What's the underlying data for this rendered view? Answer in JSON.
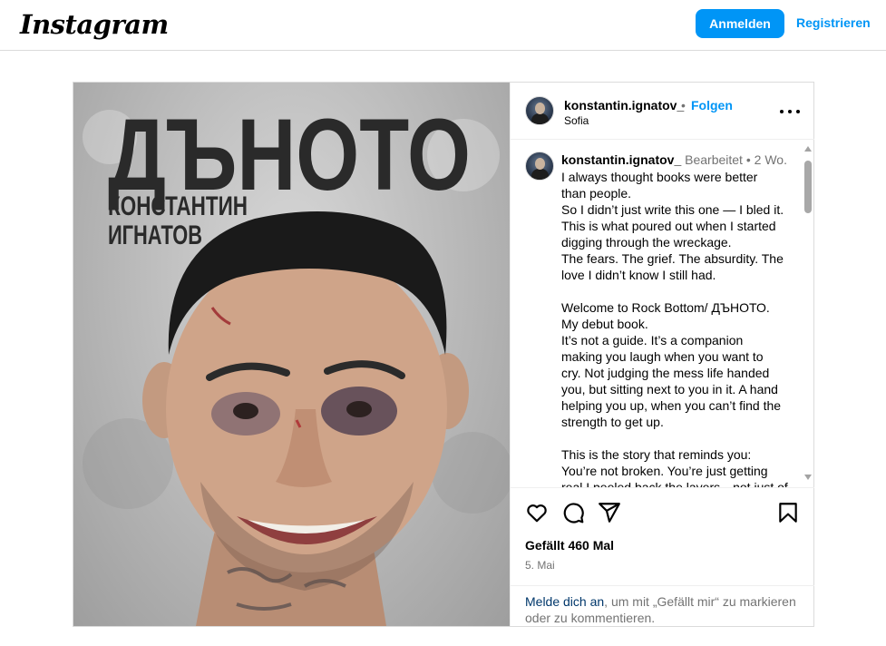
{
  "header": {
    "logo": "Instagram",
    "login_label": "Anmelden",
    "register_label": "Registrieren"
  },
  "post": {
    "image": {
      "title": "ДЪНОТО",
      "author_line1": "КОНСТАНТИН",
      "author_line2": "ИГНАТОВ"
    },
    "author": {
      "username": "konstantin.ignatov_",
      "separator": "•",
      "follow_label": "Folgen",
      "location": "Sofia"
    },
    "caption": {
      "username": "konstantin.ignatov_",
      "edited": "Bearbeitet",
      "separator": "•",
      "age": "2 Wo.",
      "lines": [
        "I always thought books were better",
        "than people.",
        "So I didn’t just write this one — I bled it.",
        "This is what poured out when I started",
        "digging through the wreckage.",
        "The fears. The grief. The absurdity. The",
        "love I didn’t know I still had.",
        "",
        "Welcome to Rock Bottom/ ДЪНОТО.",
        "My debut book.",
        "It’s not a guide. It’s a companion",
        "making you laugh when you want to",
        "cry. Not judging the mess life handed",
        "you, but sitting next to you in it. A hand",
        "helping you up, when you can’t find the",
        "strength to get up.",
        "",
        "This is the story that reminds you:",
        "You’re not broken. You’re just getting",
        "real.I peeled back the layers—not just of"
      ]
    },
    "likes": "Gefällt 460 Mal",
    "date": "5. Mai",
    "login_prompt": {
      "link": "Melde dich an",
      "rest": ", um mit „Gefällt mir“ zu markieren oder zu kommentieren."
    }
  },
  "icons": {
    "like": "heart-icon",
    "comment": "comment-icon",
    "share": "share-icon",
    "save": "bookmark-icon",
    "more": "more-options-icon"
  },
  "colors": {
    "accent": "#0095f6",
    "secondary_text": "#737373",
    "border": "#dbdbdb",
    "link_dark": "#00376b"
  }
}
